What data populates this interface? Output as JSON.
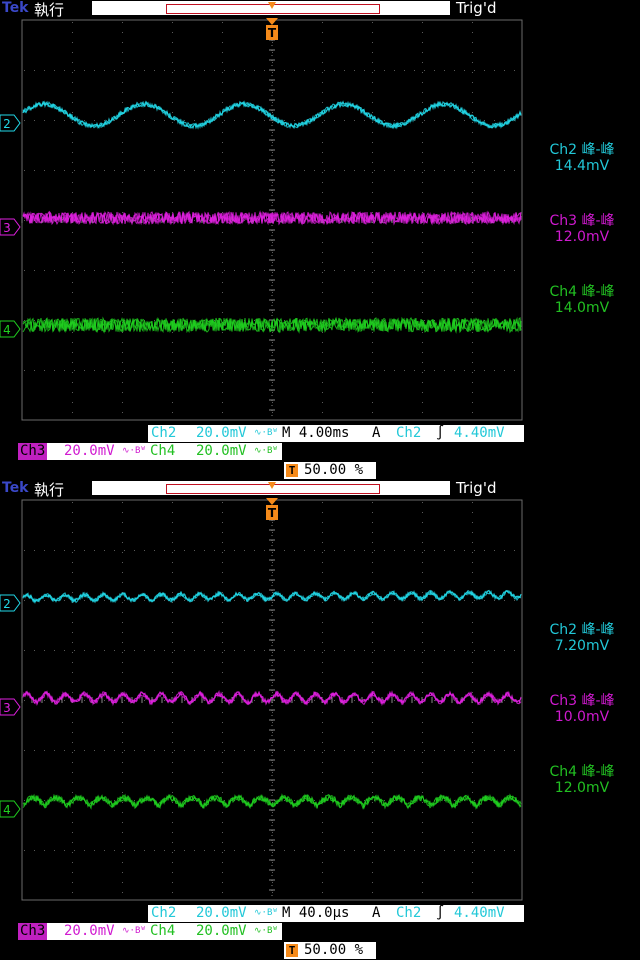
{
  "scopes": [
    {
      "brand": "Tek",
      "run_state": "執行",
      "trigger_status": "Trig'd",
      "marker_ch2": "2",
      "marker_ch3": "3",
      "marker_ch4": "4",
      "trigger_marker": "T",
      "measurements": [
        {
          "label": "Ch2 峰-峰",
          "value": "14.4mV"
        },
        {
          "label": "Ch3 峰-峰",
          "value": "12.0mV"
        },
        {
          "label": "Ch4 峰-峰",
          "value": "14.0mV"
        }
      ],
      "ch2_label": "Ch2",
      "ch2_scale": "20.0mV",
      "timebase": "M 4.00ms",
      "trigger_mode": "A",
      "trigger_source": "Ch2",
      "trigger_slope": "∫",
      "trigger_level": "4.40mV",
      "ch3_label": "Ch3",
      "ch3_scale": "20.0mV",
      "ch4_label": "Ch4",
      "ch4_scale": "20.0mV",
      "bw_symbol": "∿·Bᵂ",
      "trigger_position": "50.00 %",
      "waveforms": {
        "ch2_cycles": 5,
        "ch2_amp": 11,
        "ch3_amp": 6,
        "ch4_amp": 7,
        "ch3_ripple": 0,
        "ch4_ripple": 0
      }
    },
    {
      "brand": "Tek",
      "run_state": "執行",
      "trigger_status": "Trig'd",
      "marker_ch2": "2",
      "marker_ch3": "3",
      "marker_ch4": "4",
      "trigger_marker": "T",
      "measurements": [
        {
          "label": "Ch2 峰-峰",
          "value": "7.20mV"
        },
        {
          "label": "Ch3 峰-峰",
          "value": "10.0mV"
        },
        {
          "label": "Ch4 峰-峰",
          "value": "12.0mV"
        }
      ],
      "ch2_label": "Ch2",
      "ch2_scale": "20.0mV",
      "timebase": "M 40.0µs",
      "trigger_mode": "A",
      "trigger_source": "Ch2",
      "trigger_slope": "∫",
      "trigger_level": "4.40mV",
      "ch3_label": "Ch3",
      "ch3_scale": "20.0mV",
      "ch4_label": "Ch4",
      "ch4_scale": "20.0mV",
      "bw_symbol": "∿·Bᵂ",
      "trigger_position": "50.00 %",
      "waveforms": {
        "ch2_cycles": 0,
        "ch2_amp": 3,
        "ch3_amp": 4,
        "ch4_amp": 6,
        "ch3_ripple": 26,
        "ch4_ripple": 22
      }
    }
  ],
  "colors": {
    "ch2": "#22d8e8",
    "ch3": "#e020e0",
    "ch4": "#20d020",
    "grid": "#5a5a5a",
    "trigger": "#f58a1a"
  }
}
